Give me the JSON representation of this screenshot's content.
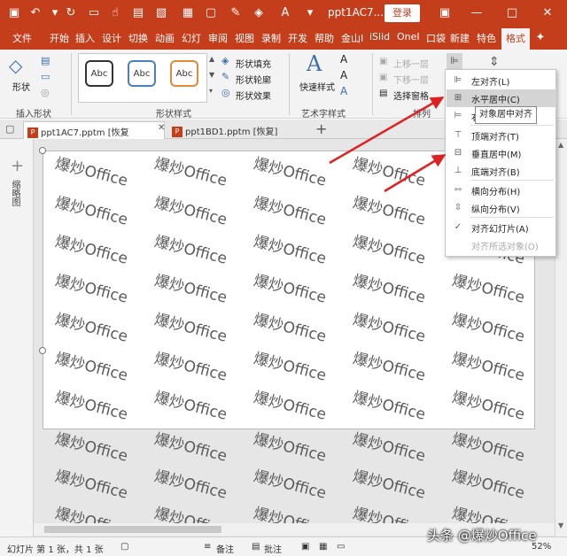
{
  "titlebar": {
    "title": "ppt1AC7...",
    "login": "登录"
  },
  "tabs": [
    "文件",
    "开始",
    "插入",
    "设计",
    "切换",
    "动画",
    "幻灯",
    "审阅",
    "视图",
    "录制",
    "开发",
    "帮助",
    "金山I",
    "iSlid",
    "OneI",
    "口袋",
    "新建",
    "特色",
    "格式"
  ],
  "ribbon": {
    "shape_label": "形状",
    "insert_shapes_group": "插入形状",
    "abc": [
      "Abc",
      "Abc",
      "Abc"
    ],
    "fill": "形状填充",
    "outline": "形状轮廓",
    "effects": "形状效果",
    "shape_styles_group": "形状样式",
    "quick_styles": "快速样式",
    "art_text_group": "艺术字样式",
    "bring_forward": "上移一层",
    "send_backward": "下移一层",
    "selection_pane": "选择窗格",
    "arrange_group": "排列"
  },
  "doc_tabs": [
    {
      "name": "ppt1AC7.pptm [恢复"
    },
    {
      "name": "ppt1BD1.pptm [恢复]"
    }
  ],
  "left_pane_label": "缩略图",
  "watermark_text": "爆炒Office",
  "align_menu": {
    "items": [
      {
        "label": "左对齐(L)",
        "icon": "align-left-icon",
        "disabled": false
      },
      {
        "label": "水平居中(C)",
        "icon": "align-center-icon",
        "disabled": false
      },
      {
        "label": "右对齐(R)",
        "icon": "align-right-icon",
        "disabled": false
      },
      {
        "label": "顶端对齐(T)",
        "icon": "align-top-icon",
        "disabled": false
      },
      {
        "label": "垂直居中(M)",
        "icon": "align-middle-icon",
        "disabled": false
      },
      {
        "label": "底端对齐(B)",
        "icon": "align-bottom-icon",
        "disabled": false
      },
      {
        "label": "横向分布(H)",
        "icon": "distribute-horizontal-icon",
        "disabled": false
      },
      {
        "label": "纵向分布(V)",
        "icon": "distribute-vertical-icon",
        "disabled": false
      },
      {
        "label": "对齐幻灯片(A)",
        "icon": "check-icon",
        "disabled": false
      },
      {
        "label": "对齐所选对象(O)",
        "icon": "",
        "disabled": true
      }
    ],
    "tooltip": "对象居中对齐"
  },
  "status": {
    "slide_info": "幻灯片 第 1 张，共 1 张",
    "notes": "备注",
    "comments": "批注",
    "zoom": "52%"
  },
  "brand_watermark": "头条 @爆炒Office",
  "colors": {
    "accent": "#c43e1c",
    "arrow": "#e02020"
  }
}
